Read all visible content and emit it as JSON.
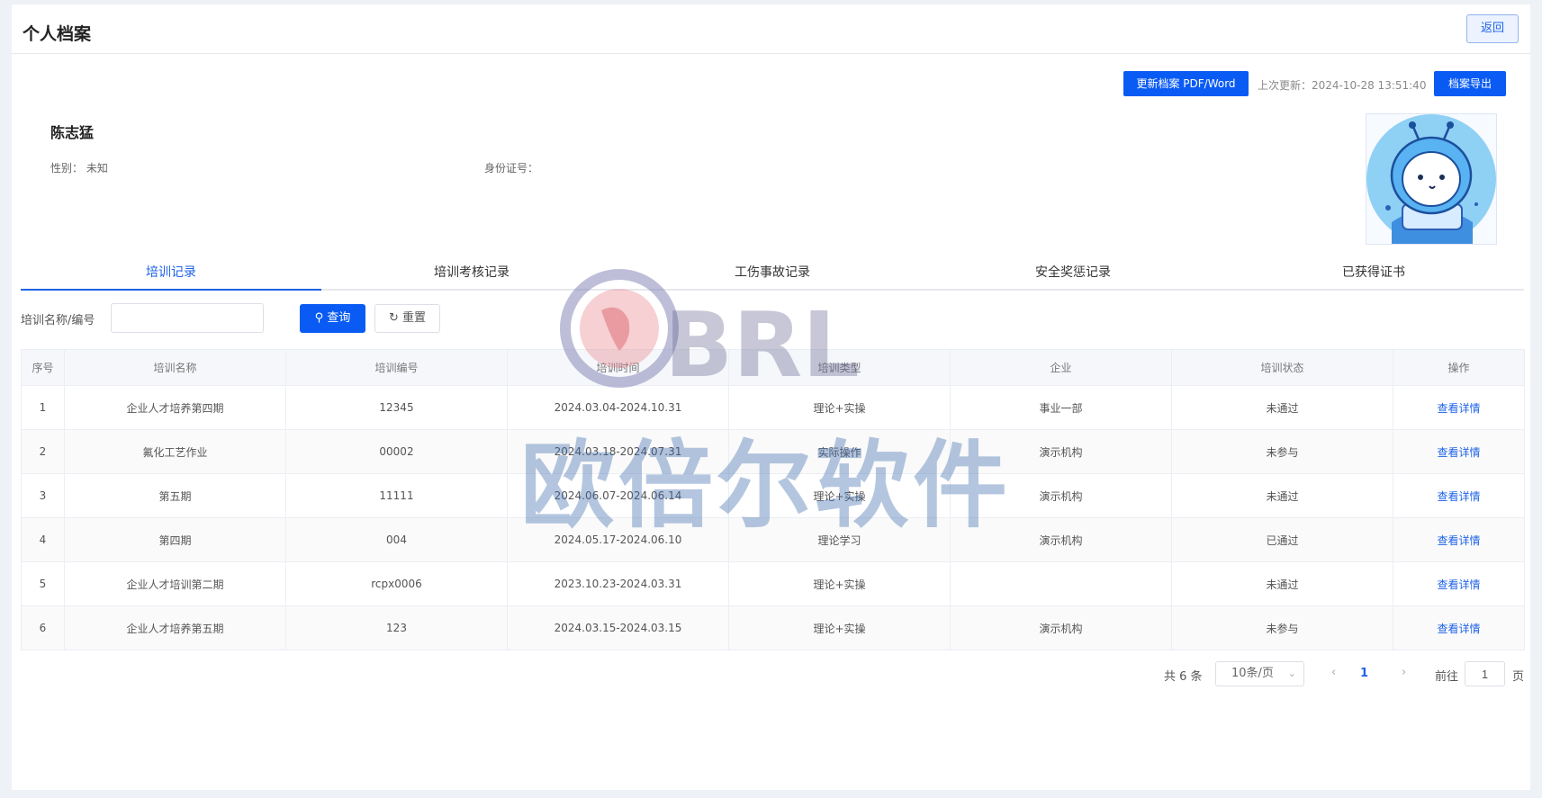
{
  "header": {
    "title": "个人档案",
    "back_label": "返回"
  },
  "actions": {
    "update_label": "更新档案 PDF/Word",
    "last_update": "上次更新：2024-10-28 13:51:40",
    "export_label": "档案导出"
  },
  "person": {
    "name": "陈志猛",
    "gender_label": "性别：",
    "gender_value": "未知",
    "idcard_label": "身份证号："
  },
  "tabs": [
    "培训记录",
    "培训考核记录",
    "工伤事故记录",
    "安全奖惩记录",
    "已获得证书"
  ],
  "search": {
    "label": "培训名称/编号",
    "value": "",
    "query_label": "查询",
    "reset_label": "重置"
  },
  "table": {
    "headers": [
      "序号",
      "培训名称",
      "培训编号",
      "培训时间",
      "培训类型",
      "企业",
      "培训状态",
      "操作"
    ],
    "rows": [
      [
        "1",
        "企业人才培养第四期",
        "12345",
        "2024.03.04-2024.10.31",
        "理论+实操",
        "事业一部",
        "未通过",
        "查看详情"
      ],
      [
        "2",
        "氟化工艺作业",
        "00002",
        "2024.03.18-2024.07.31",
        "实际操作",
        "演示机构",
        "未参与",
        "查看详情"
      ],
      [
        "3",
        "第五期",
        "11111",
        "2024.06.07-2024.06.14",
        "理论+实操",
        "演示机构",
        "未通过",
        "查看详情"
      ],
      [
        "4",
        "第四期",
        "004",
        "2024.05.17-2024.06.10",
        "理论学习",
        "演示机构",
        "已通过",
        "查看详情"
      ],
      [
        "5",
        "企业人才培训第二期",
        "rcpx0006",
        "2023.10.23-2024.03.31",
        "理论+实操",
        "",
        "未通过",
        "查看详情"
      ],
      [
        "6",
        "企业人才培养第五期",
        "123",
        "2024.03.15-2024.03.15",
        "理论+实操",
        "演示机构",
        "未参与",
        "查看详情"
      ]
    ]
  },
  "pagination": {
    "total": "共 6 条",
    "page_size": "10条/页",
    "current_page": "1",
    "goto_label": "前往",
    "goto_value": "1",
    "page_unit": "页"
  },
  "watermark": {
    "brand": "BRL",
    "text": "欧倍尔软件"
  },
  "colors": {
    "primary": "#0a5bf4",
    "link": "#1f63e6"
  }
}
